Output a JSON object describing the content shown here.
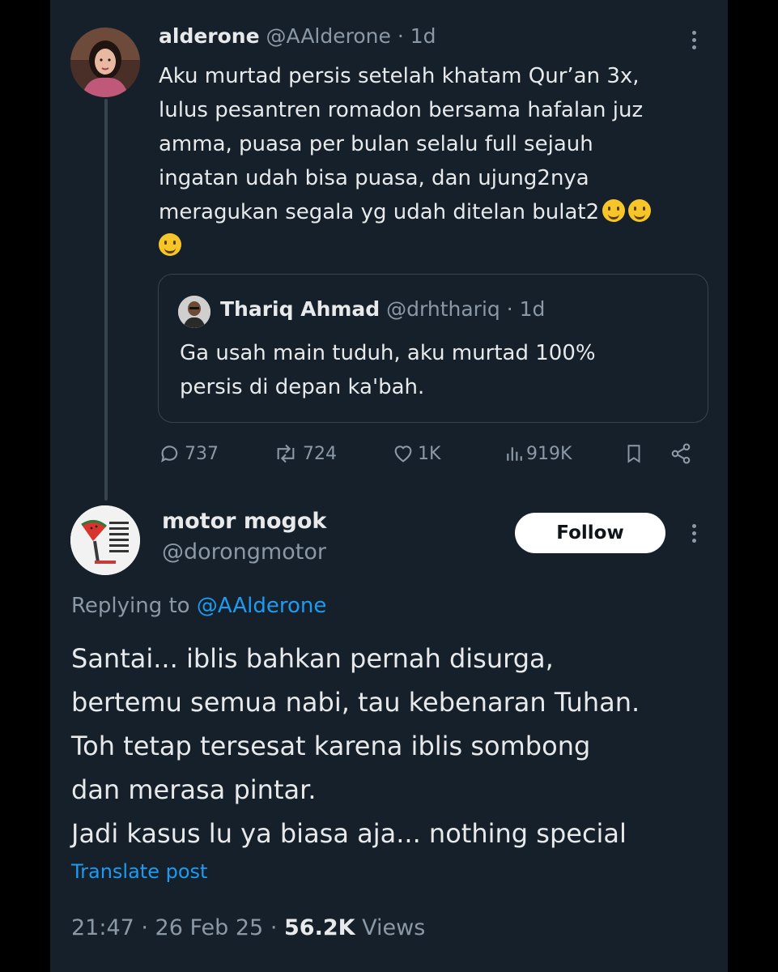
{
  "original_post": {
    "display_name": "alderone",
    "handle": "@AAlderone",
    "time": "· 1d",
    "text_lines": [
      "Aku murtad persis setelah khatam Qur’an 3x,",
      "lulus pesantren romadon bersama hafalan juz",
      "amma, puasa per bulan selalu full sejauh",
      "ingatan udah bisa puasa, dan ujung2nya",
      "meragukan segala yg udah ditelan bulat2"
    ],
    "emoji_icon": "melting-face-icon",
    "quoted": {
      "display_name": "Thariq Ahmad",
      "handle": "@drhthariq",
      "time": "· 1d",
      "text_lines": [
        "Ga usah main tuduh, aku murtad 100%",
        "persis di depan ka'bah."
      ]
    },
    "stats": {
      "replies": "737",
      "reposts": "724",
      "likes": "1K",
      "views": "919K"
    }
  },
  "reply_post": {
    "display_name": "motor mogok",
    "handle": "@dorongmotor",
    "follow_label": "Follow",
    "replying_prefix": "Replying to",
    "replying_to": "@AAlderone",
    "text_lines": [
      "Santai... iblis bahkan pernah disurga,",
      "bertemu semua nabi, tau kebenaran Tuhan.",
      "Toh tetap tersesat karena iblis sombong",
      "dan merasa pintar.",
      "Jadi kasus lu ya biasa aja... nothing special"
    ],
    "translate_label": "Translate post",
    "timestamp": "21:47 · 26 Feb 25 ·",
    "views_count": "56.2K",
    "views_label": "Views"
  },
  "colors": {
    "background": "#15202b",
    "text": "#e7e9ea",
    "muted": "#8b98a5",
    "link": "#1d9bf0",
    "border": "#38444d"
  }
}
